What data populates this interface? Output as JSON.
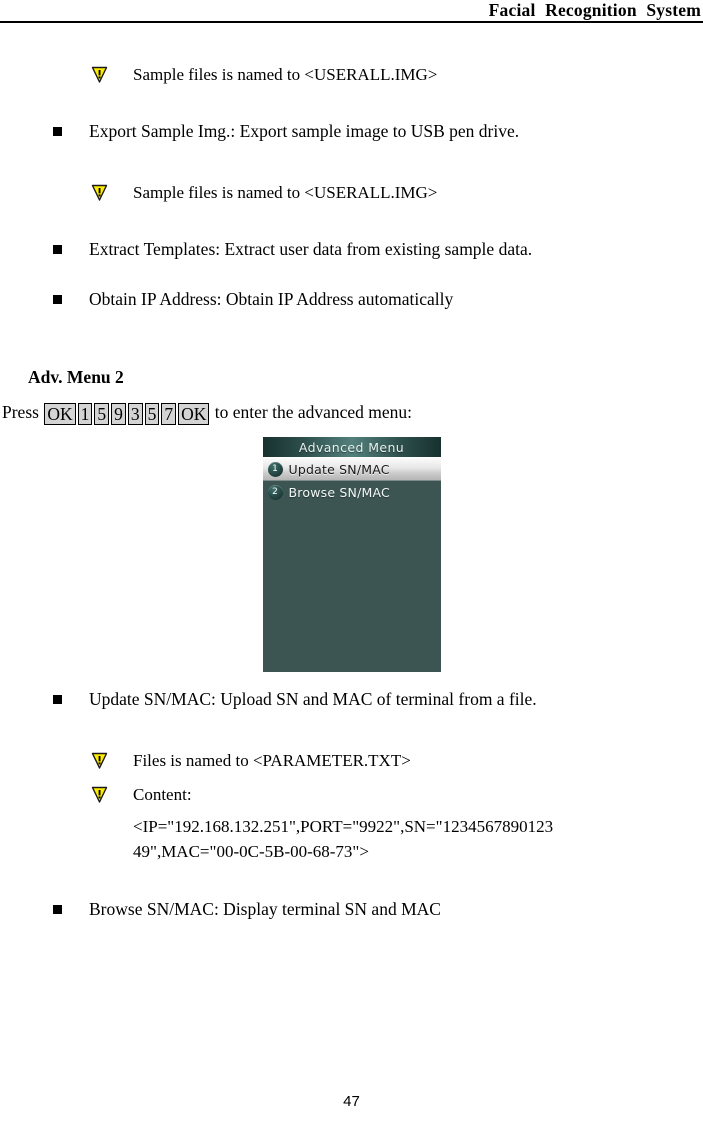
{
  "header": {
    "title": "Facial  Recognition  System"
  },
  "body_blocks": [
    {
      "type": "note",
      "icon": "warning-triangle-icon",
      "text": "Sample files is named to <USERALL.IMG>"
    },
    {
      "type": "bullet",
      "text": "Export Sample Img.: Export sample image to USB pen drive."
    },
    {
      "type": "note",
      "icon": "warning-triangle-icon",
      "text": "Sample files is named to <USERALL.IMG>"
    },
    {
      "type": "bullet",
      "text": "Extract Templates: Extract user data from existing sample data."
    },
    {
      "type": "bullet",
      "text": "Obtain IP Address: Obtain IP Address automatically"
    }
  ],
  "section": {
    "heading": "Adv. Menu 2",
    "press_prefix": "Press",
    "keys": [
      "OK",
      "1",
      "5",
      "9",
      "3",
      "5",
      "7",
      "OK"
    ],
    "press_suffix": "to enter the advanced menu:"
  },
  "device": {
    "title": "Advanced Menu",
    "items": [
      {
        "number": "1",
        "label": "Update SN/MAC",
        "selected": true
      },
      {
        "number": "2",
        "label": "Browse SN/MAC",
        "selected": false
      }
    ],
    "colors": {
      "background": "#3c5552",
      "titlebar_center": "#53807c",
      "titlebar_edge": "#17312f",
      "badge": "#1d3b39",
      "selected_row": "#e9e9e9"
    }
  },
  "body_blocks_after": [
    {
      "type": "bullet",
      "text": "Update SN/MAC: Upload SN and MAC of terminal from a file."
    },
    {
      "type": "note",
      "icon": "warning-triangle-icon",
      "text": "Files is named to <PARAMETER.TXT>"
    },
    {
      "type": "note",
      "icon": "warning-triangle-icon",
      "text": "Content:"
    },
    {
      "type": "cont",
      "text": "<IP=\"192.168.132.251\",PORT=\"9922\",SN=\"1234567890123"
    },
    {
      "type": "cont",
      "text": "49\",MAC=\"00-0C-5B-00-68-73\">"
    },
    {
      "type": "bullet",
      "text": "Browse SN/MAC: Display terminal SN and MAC"
    }
  ],
  "footer": {
    "page_number": "47"
  }
}
